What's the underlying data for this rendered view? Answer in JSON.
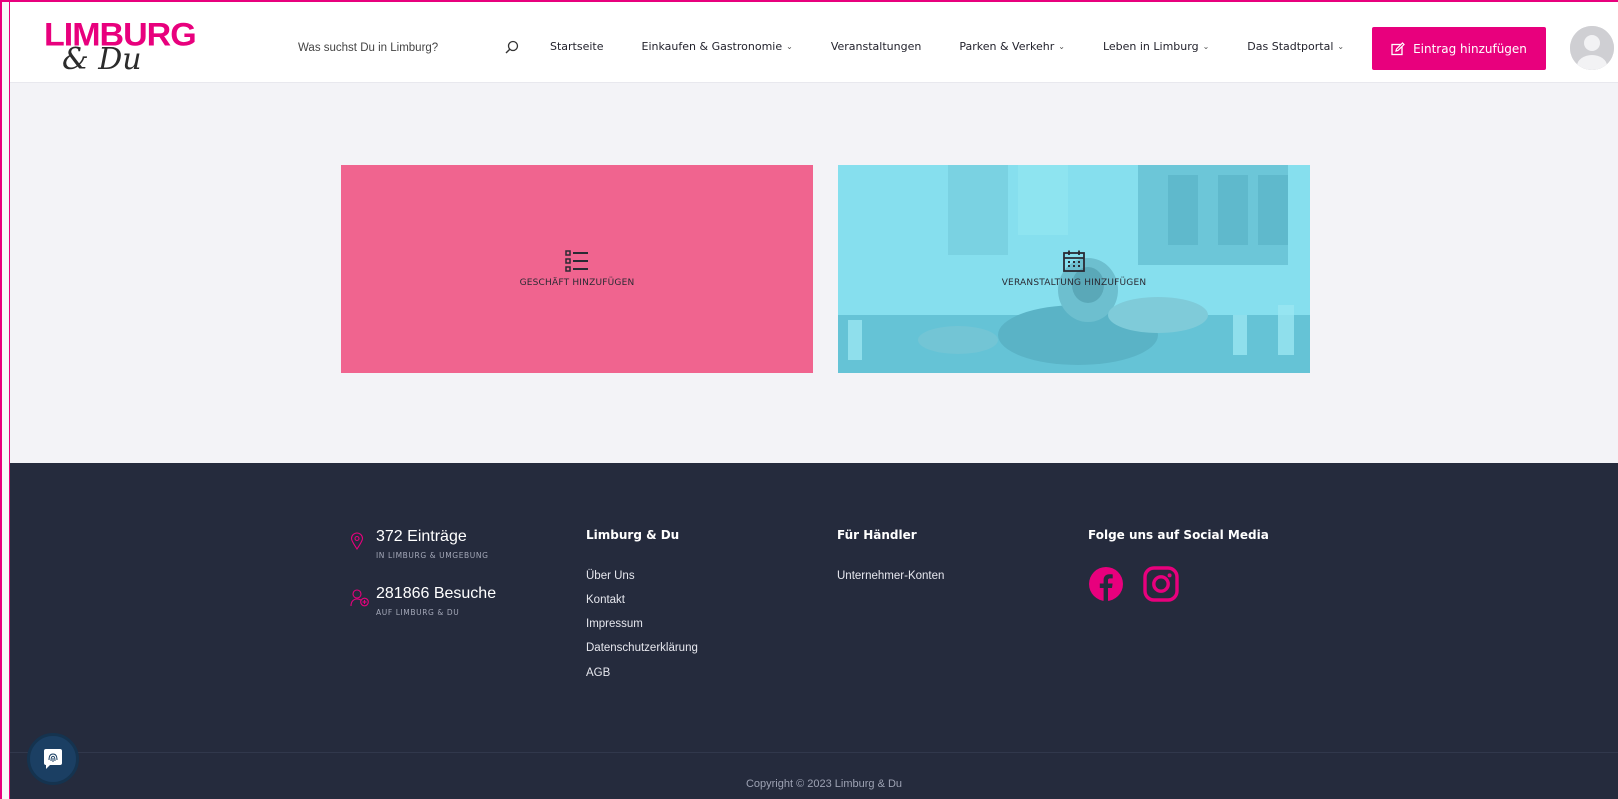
{
  "brand": {
    "logo_line1": "LIMBURG",
    "logo_line2": "& Du",
    "accent_color": "#e8007d"
  },
  "search": {
    "placeholder": "Was suchst Du in Limburg?",
    "icon": "search-icon"
  },
  "nav": {
    "items": [
      {
        "label": "Startseite",
        "has_dropdown": false
      },
      {
        "label": "Einkaufen & Gastronomie",
        "has_dropdown": true
      },
      {
        "label": "Veranstaltungen",
        "has_dropdown": false
      },
      {
        "label": "Parken & Verkehr",
        "has_dropdown": true
      },
      {
        "label": "Leben in Limburg",
        "has_dropdown": true
      },
      {
        "label": "Das Stadtportal",
        "has_dropdown": true
      }
    ],
    "chevron": "⌄"
  },
  "header": {
    "add_entry_label": "Eintrag hinzufügen",
    "add_entry_icon": "edit-icon",
    "avatar_icon": "user-avatar-icon"
  },
  "cards": {
    "shop": {
      "label": "GESCHÄFT HINZUFÜGEN",
      "icon": "list-icon",
      "color": "#f0648f"
    },
    "event": {
      "label": "VERANSTALTUNG HINZUFÜGEN",
      "icon": "calendar-icon",
      "color": "#7fd9e8"
    }
  },
  "footer": {
    "stats": [
      {
        "value": "372 Einträge",
        "caption": "IN LIMBURG & UMGEBUNG",
        "icon": "map-pin-icon"
      },
      {
        "value": "281866 Besuche",
        "caption": "AUF LIMBURG & DU",
        "icon": "user-visits-icon"
      }
    ],
    "col_limburg": {
      "title": "Limburg & Du",
      "links": [
        "Über Uns",
        "Kontakt",
        "Impressum",
        "Datenschutzerklärung",
        "AGB"
      ]
    },
    "col_haendler": {
      "title": "Für Händler",
      "links": [
        "Unternehmer-Konten"
      ]
    },
    "col_social": {
      "title": "Folge uns auf Social Media",
      "icons": [
        "facebook-icon",
        "instagram-icon"
      ]
    },
    "copyright": "Copyright © 2023 Limburg & Du",
    "background": "#252b3d"
  },
  "chat": {
    "icon": "fingerprint-chat-icon"
  }
}
